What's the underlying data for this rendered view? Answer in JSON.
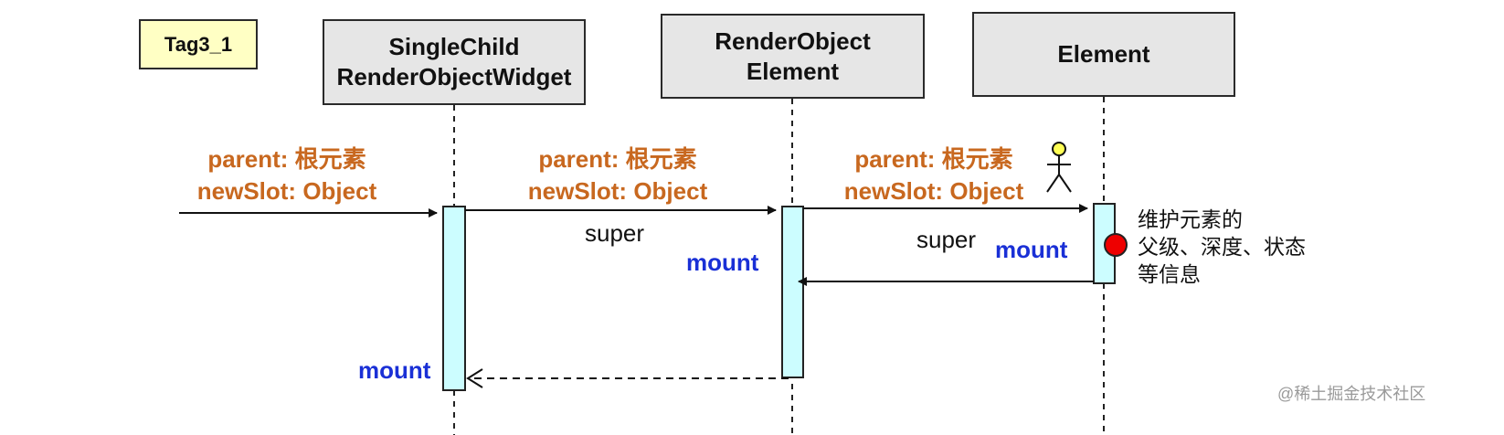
{
  "tag": "Tag3_1",
  "lifelines": [
    {
      "id": "widget",
      "title": "SingleChild\nRenderObjectWidget"
    },
    {
      "id": "roe",
      "title": "RenderObject\nElement"
    },
    {
      "id": "element",
      "title": "Element"
    }
  ],
  "messages": {
    "call1": {
      "params": "parent: 根元素\nnewSlot: Object",
      "method": "mount"
    },
    "call2": {
      "params": "parent: 根元素\nnewSlot: Object",
      "kind": "super",
      "method": "mount"
    },
    "call3": {
      "params": "parent: 根元素\nnewSlot: Object",
      "kind": "super",
      "method": "mount"
    },
    "return_final": {
      "method": "mount"
    }
  },
  "note": "维护元素的\n父级、深度、状态\n等信息",
  "watermark": "@稀土掘金技术社区",
  "colors": {
    "param_text": "#c8681f",
    "method_text": "#1a30d6",
    "activation_fill": "#ccfdff",
    "lifeline_box_fill": "#e6e6e6",
    "tag_fill": "#ffffc4",
    "marker_fill": "#ee0000",
    "actor_head": "#ffff55"
  },
  "icons": [
    "actor-icon",
    "breakpoint-marker-icon"
  ]
}
